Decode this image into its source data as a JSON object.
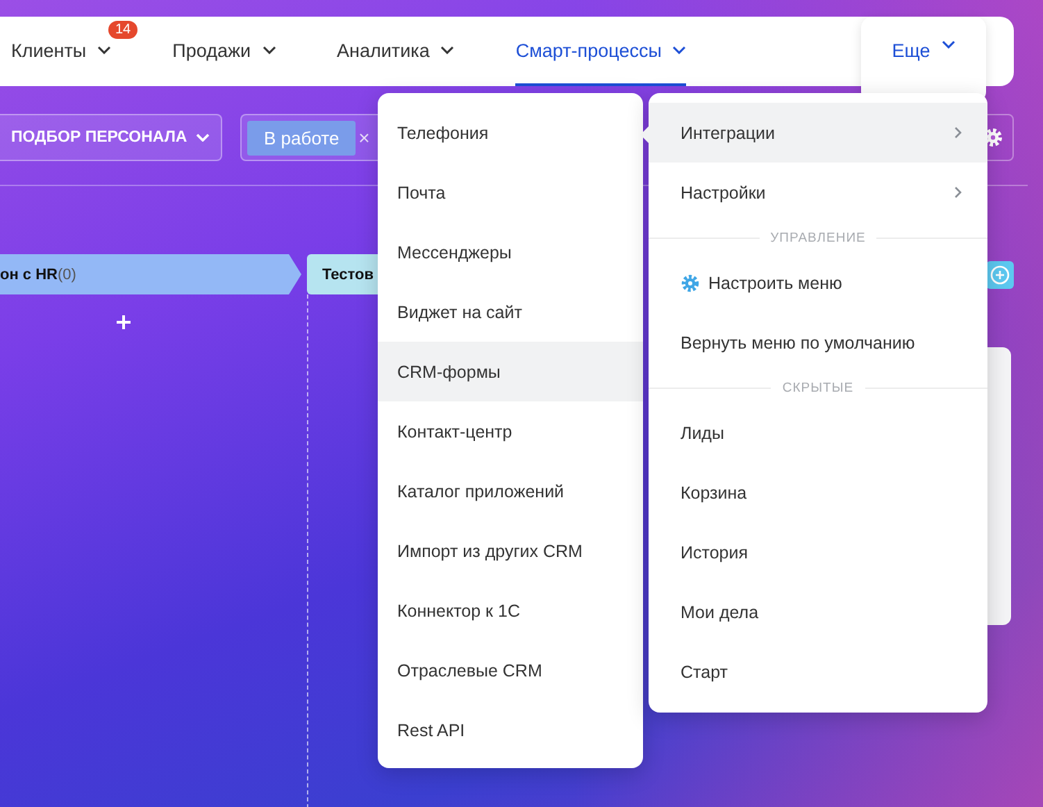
{
  "nav": {
    "tabs": [
      {
        "label": "Клиенты",
        "badge": "14",
        "selected": false
      },
      {
        "label": "Продажи",
        "selected": false
      },
      {
        "label": "Аналитика",
        "selected": false
      },
      {
        "label": "Смарт-процессы",
        "selected": true
      }
    ],
    "more": {
      "label": "Еще",
      "open": true
    }
  },
  "toolbar": {
    "category": "ПОДБОР ПЕРСОНАЛА",
    "filter_chip": "В работе",
    "chip_remove": "×"
  },
  "stages": [
    {
      "title": "он с HR",
      "count": "(0)",
      "color": "#93b8f6"
    },
    {
      "title": "Тестов",
      "color": "#b6e4f0"
    }
  ],
  "submenu": [
    {
      "label": "Телефония",
      "selected": false
    },
    {
      "label": "Почта",
      "selected": false
    },
    {
      "label": "Мессенджеры",
      "selected": false
    },
    {
      "label": "Виджет на сайт",
      "selected": false
    },
    {
      "label": "CRM-формы",
      "selected": true
    },
    {
      "label": "Контакт-центр",
      "selected": false
    },
    {
      "label": "Каталог приложений",
      "selected": false
    },
    {
      "label": "Импорт из других CRM",
      "selected": false
    },
    {
      "label": "Коннектор к 1С",
      "selected": false
    },
    {
      "label": "Отраслевые CRM",
      "selected": false
    },
    {
      "label": "Rest API",
      "selected": false
    }
  ],
  "menu": [
    {
      "kind": "item",
      "label": "Интеграции",
      "submenu": true,
      "selected": true
    },
    {
      "kind": "item",
      "label": "Настройки",
      "submenu": true,
      "selected": false
    },
    {
      "kind": "section",
      "label": "УПРАВЛЕНИЕ"
    },
    {
      "kind": "gear",
      "label": "Настроить меню",
      "selected": false
    },
    {
      "kind": "item",
      "label": "Вернуть меню по умолчанию",
      "submenu": false,
      "selected": false
    },
    {
      "kind": "section",
      "label": "СКРЫТЫЕ"
    },
    {
      "kind": "item",
      "label": "Лиды",
      "submenu": false,
      "selected": false
    },
    {
      "kind": "item",
      "label": "Корзина",
      "submenu": false,
      "selected": false
    },
    {
      "kind": "item",
      "label": "История",
      "submenu": false,
      "selected": false
    },
    {
      "kind": "item",
      "label": "Мои дела",
      "submenu": false,
      "selected": false
    },
    {
      "kind": "item",
      "label": "Старт",
      "submenu": false,
      "selected": false
    }
  ]
}
